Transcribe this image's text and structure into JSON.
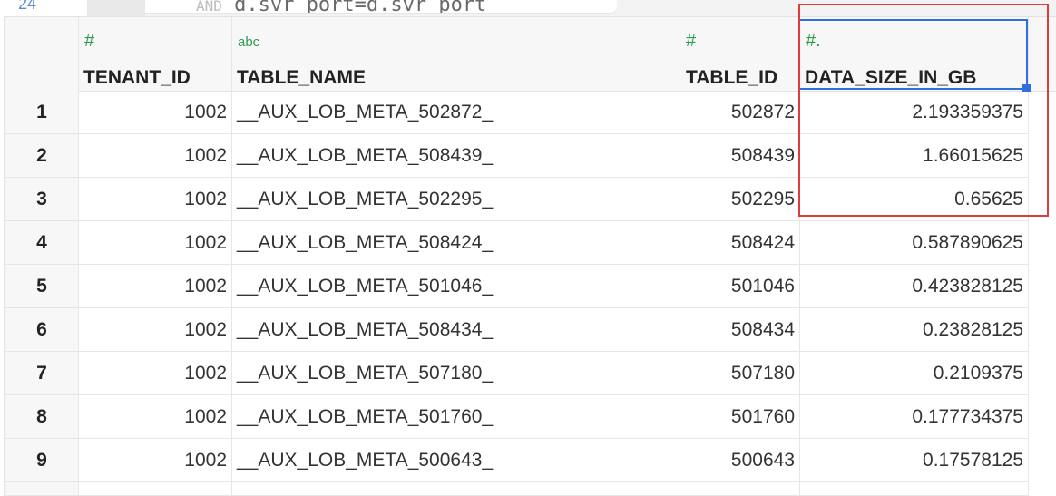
{
  "editor": {
    "line_number": "24",
    "code_line": "AND  d.svr_port=d.svr_port",
    "code_keyword": "AND",
    "code_rest": "d.svr_port=d.svr_port"
  },
  "columns": [
    {
      "name": "TENANT_ID",
      "type_icon": "#",
      "type": "number"
    },
    {
      "name": "TABLE_NAME",
      "type_icon": "abc",
      "type": "text"
    },
    {
      "name": "TABLE_ID",
      "type_icon": "#",
      "type": "number"
    },
    {
      "name": "DATA_SIZE_IN_GB",
      "type_icon": "#.",
      "type": "decimal"
    }
  ],
  "rows": [
    {
      "n": "1",
      "tenant_id": "1002",
      "table_name": "__AUX_LOB_META_502872_",
      "table_id": "502872",
      "data_size": "2.193359375"
    },
    {
      "n": "2",
      "tenant_id": "1002",
      "table_name": "__AUX_LOB_META_508439_",
      "table_id": "508439",
      "data_size": "1.66015625"
    },
    {
      "n": "3",
      "tenant_id": "1002",
      "table_name": "__AUX_LOB_META_502295_",
      "table_id": "502295",
      "data_size": "0.65625"
    },
    {
      "n": "4",
      "tenant_id": "1002",
      "table_name": "__AUX_LOB_META_508424_",
      "table_id": "508424",
      "data_size": "0.587890625"
    },
    {
      "n": "5",
      "tenant_id": "1002",
      "table_name": "__AUX_LOB_META_501046_",
      "table_id": "501046",
      "data_size": "0.423828125"
    },
    {
      "n": "6",
      "tenant_id": "1002",
      "table_name": "__AUX_LOB_META_508434_",
      "table_id": "508434",
      "data_size": "0.23828125"
    },
    {
      "n": "7",
      "tenant_id": "1002",
      "table_name": "__AUX_LOB_META_507180_",
      "table_id": "507180",
      "data_size": "0.2109375"
    },
    {
      "n": "8",
      "tenant_id": "1002",
      "table_name": "__AUX_LOB_META_501760_",
      "table_id": "501760",
      "data_size": "0.177734375"
    },
    {
      "n": "9",
      "tenant_id": "1002",
      "table_name": "__AUX_LOB_META_500643_",
      "table_id": "500643",
      "data_size": "0.17578125"
    }
  ],
  "colors": {
    "type_icon": "#2f9d4f",
    "selection": "#2f6fe0",
    "highlight_box": "#e23b3b",
    "header_bg": "#f7f7f7"
  }
}
